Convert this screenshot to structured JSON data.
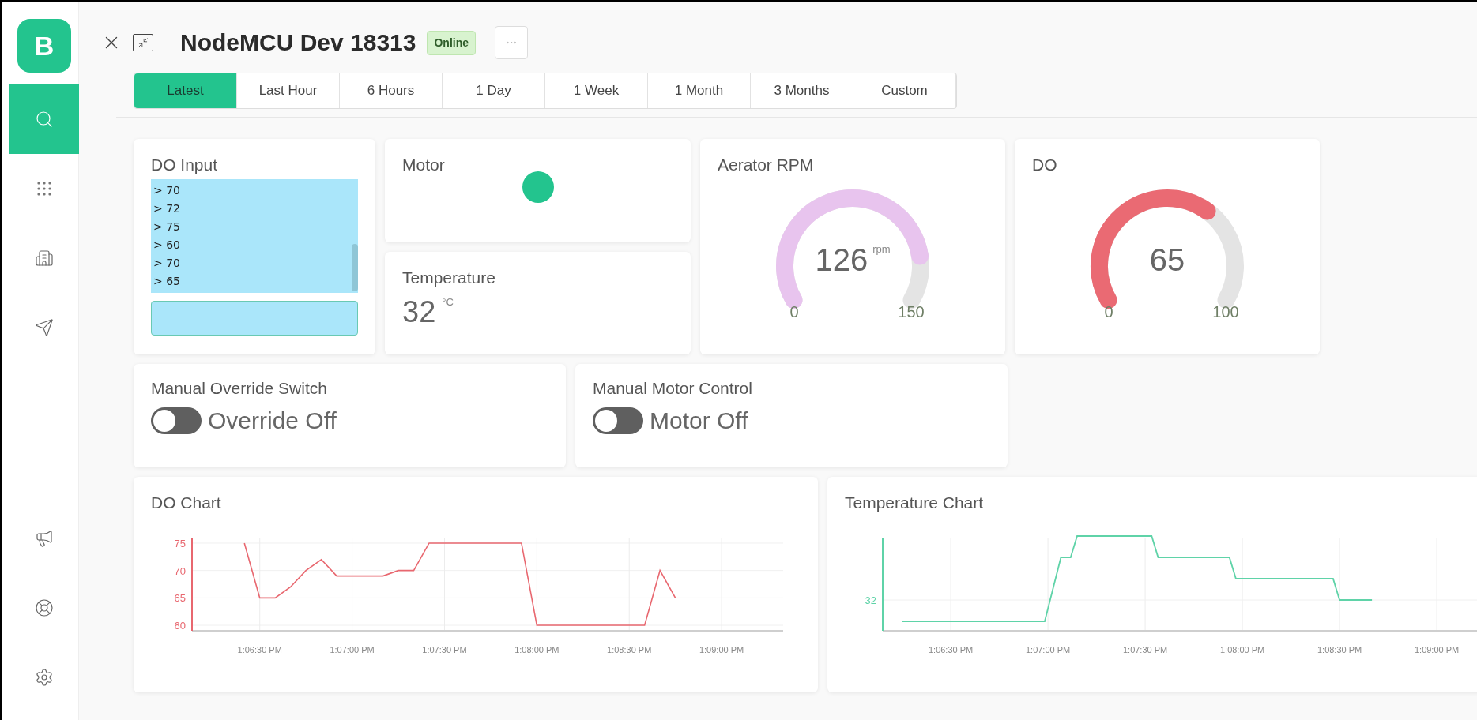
{
  "sidebar": {
    "logo": "B",
    "items": [
      {
        "kind": "search",
        "selected": true
      },
      {
        "kind": "apps",
        "selected": false
      },
      {
        "kind": "building",
        "selected": false
      },
      {
        "kind": "send",
        "selected": false
      },
      {
        "kind": "announce",
        "selected": false
      },
      {
        "kind": "help",
        "selected": false
      },
      {
        "kind": "settings",
        "selected": false
      }
    ]
  },
  "header": {
    "title": "NodeMCU Dev 18313",
    "status": "Online",
    "tabs": [
      {
        "label": "Latest",
        "selected": true
      },
      {
        "label": "Last Hour",
        "selected": false
      },
      {
        "label": "6 Hours",
        "selected": false
      },
      {
        "label": "1 Day",
        "selected": false
      },
      {
        "label": "1 Week",
        "selected": false
      },
      {
        "label": "1 Month",
        "selected": false
      },
      {
        "label": "3 Months",
        "selected": false
      },
      {
        "label": "Custom",
        "selected": false
      }
    ]
  },
  "do_input": {
    "title": "DO Input",
    "lines": [
      "> 70",
      "> 72",
      "> 75",
      "> 60",
      "> 70",
      "> 65"
    ]
  },
  "motor": {
    "title": "Motor",
    "on": true
  },
  "temperature": {
    "title": "Temperature",
    "value": "32",
    "unit": "°C"
  },
  "gauges": [
    {
      "title": "Aerator RPM",
      "value": "126",
      "unit": "rpm",
      "min": "0",
      "max": "150",
      "color": "#e8c4ee"
    },
    {
      "title": "DO",
      "value": "65",
      "min": "0",
      "max": "100",
      "color": "#ea6a73"
    }
  ],
  "switches": [
    {
      "title": "Manual Override Switch",
      "label": "Override Off",
      "on": false
    },
    {
      "title": "Manual Motor Control",
      "label": "Motor Off",
      "on": false
    }
  ],
  "do_chart": {
    "title": "DO Chart",
    "chart_data": {
      "type": "line",
      "categories": [
        null,
        null,
        "1:06:30 PM",
        null,
        null,
        null,
        null,
        null,
        "1:07:00 PM",
        null,
        null,
        null,
        null,
        null,
        "1:07:30 PM",
        null,
        null,
        null,
        null,
        null,
        "1:08:00 PM",
        null,
        null,
        null,
        null,
        null,
        "1:08:30 PM",
        null,
        null,
        null,
        null,
        null,
        "1:09:00 PM",
        null,
        null,
        null
      ],
      "series": [
        {
          "color": "#e8676f",
          "values": [
            null,
            75,
            65,
            65,
            67,
            70,
            72,
            69,
            69,
            69,
            69,
            70,
            70,
            75,
            75,
            75,
            75,
            75,
            75,
            75,
            60,
            60,
            60,
            60,
            60,
            60,
            60,
            60,
            70,
            65,
            null,
            null,
            null,
            null,
            null,
            null
          ]
        }
      ],
      "ylim": [
        59,
        76
      ],
      "yticks": [
        60,
        65,
        70,
        75
      ],
      "grid": true
    }
  },
  "temperature_chart": {
    "title": "Temperature Chart",
    "y_label": "32",
    "x_labels": [
      "1:06:30 PM",
      "1:07:00 PM",
      "1:07:30 PM",
      "1:08:00 PM",
      "1:08:30 PM",
      "1:09:00 PM"
    ]
  }
}
